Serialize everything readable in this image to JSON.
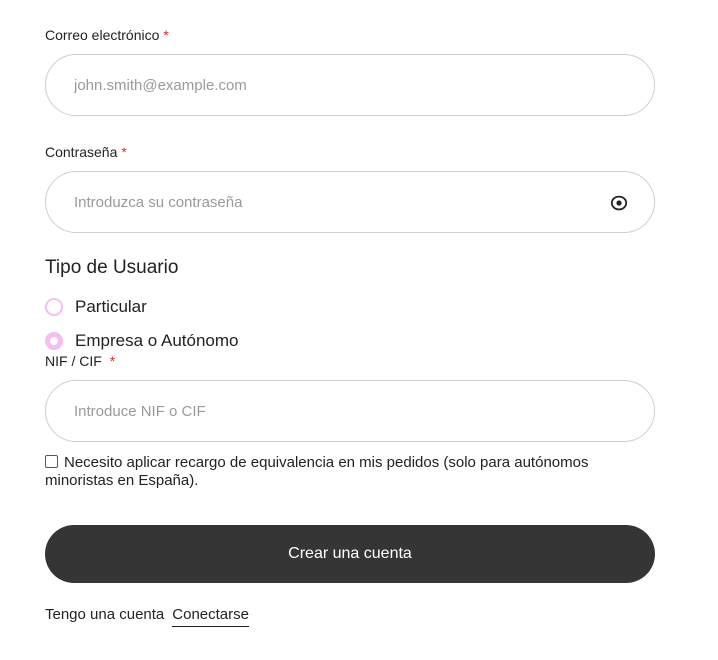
{
  "email": {
    "label": "Correo electrónico",
    "required_mark": "*",
    "placeholder": "john.smith@example.com",
    "value": ""
  },
  "password": {
    "label": "Contraseña",
    "required_mark": "*",
    "placeholder": "Introduzca su contraseña",
    "value": "",
    "toggle_icon": "eye-icon"
  },
  "user_type": {
    "title": "Tipo de Usuario",
    "options": [
      {
        "label": "Particular",
        "selected": false
      },
      {
        "label": "Empresa o Autónomo",
        "selected": true
      }
    ]
  },
  "nif": {
    "label": "NIF / CIF",
    "required_mark": "*",
    "placeholder": "Introduce NIF o CIF",
    "value": ""
  },
  "surcharge": {
    "label": "Necesito aplicar recargo de equivalencia en mis pedidos (solo para autónomos minoristas en España).",
    "checked": false
  },
  "submit_label": "Crear una cuenta",
  "login": {
    "prompt": "Tengo una cuenta",
    "link_label": "Conectarse"
  },
  "colors": {
    "required": "#e02b2b",
    "radio_accent": "#f6bdf0",
    "button_bg": "#353535",
    "input_border": "#cfcfcf"
  }
}
